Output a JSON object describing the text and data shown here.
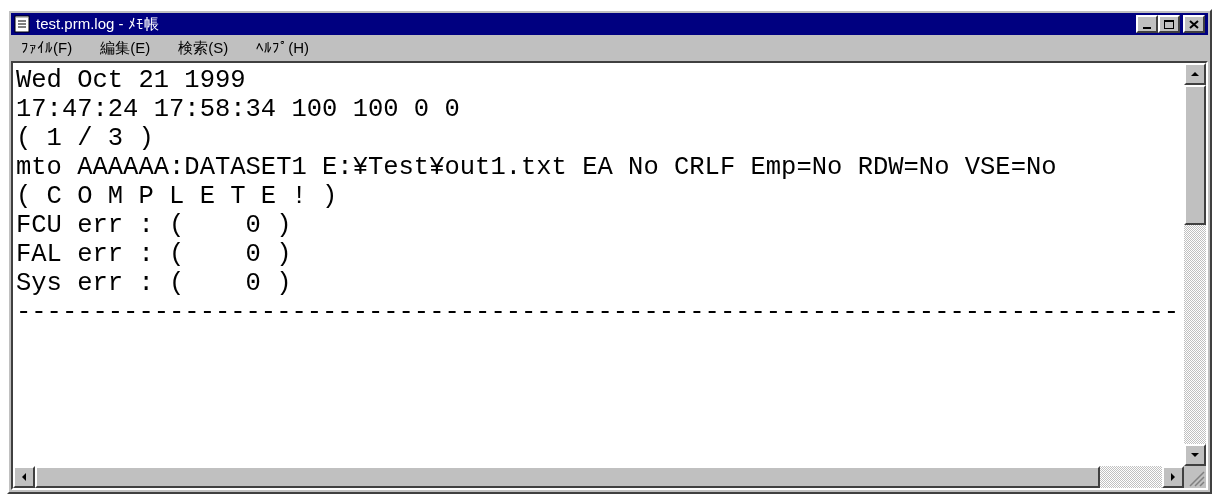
{
  "window": {
    "title": "test.prm.log - ﾒﾓ帳"
  },
  "menu": [
    {
      "label": "ﾌｧｲﾙ(F)"
    },
    {
      "label": "編集(E)"
    },
    {
      "label": "検索(S)"
    },
    {
      "label": "ﾍﾙﾌﾟ(H)"
    }
  ],
  "editor": {
    "lines": [
      "Wed Oct 21 1999",
      "17:47:24 17:58:34 100 100 0 0",
      "( 1 / 3 )",
      "mto AAAAAA:DATASET1 E:¥Test¥out1.txt EA No CRLF Emp=No RDW=No VSE=No",
      "( C O M P L E T E ! )",
      "FCU err : (    0 )",
      "FAL err : (    0 )",
      "Sys err : (    0 )",
      "----------------------------------------------------------------------------"
    ]
  }
}
